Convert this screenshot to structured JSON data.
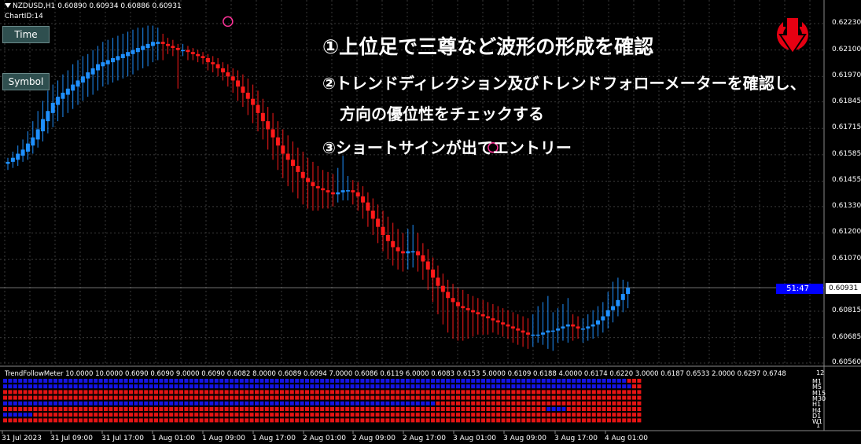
{
  "header": {
    "symbol_line": "NZDUSD,H1  0.60890 0.60934 0.60886 0.60931",
    "chart_id": "ChartID:14"
  },
  "buttons": {
    "time": "Time",
    "symbol": "Symbol"
  },
  "annotations": {
    "line1": "①上位足で三尊など波形の形成を確認",
    "line2": "②トレンドディレクション及びトレンドフォローメーターを確認し、",
    "line3": "方向の優位性をチェックする",
    "line4": "③ショートサインが出てエントリー"
  },
  "price_axis": {
    "labels": [
      "0.62230",
      "0.62100",
      "0.61970",
      "0.61845",
      "0.61715",
      "0.61585",
      "0.61455",
      "0.61330",
      "0.61200",
      "0.61070",
      "0.60815",
      "0.60685",
      "0.60560"
    ],
    "current_price": "0.60931",
    "timer": "51:47"
  },
  "indicator": {
    "title": "TrendFollowMeter 10.0000 10.0000 0.6090 0.6090 9.0000 0.6090 0.6082 8.0000 0.6089 0.6094 7.0000 0.6086 0.6119 6.0000 0.6083 0.6153 5.0000 0.6109 0.6188 4.0000 0.6174 0.6220 3.0000 0.6187 0.6533 2.0000 0.6297 0.6748",
    "scale_top": "12",
    "scale_bottom": "1",
    "timeframes": [
      "M1",
      "M5",
      "M15",
      "M30",
      "H1",
      "H4",
      "D1",
      "W1"
    ]
  },
  "time_axis": [
    "31 Jul 2023",
    "31 Jul 09:00",
    "31 Jul 17:00",
    "1 Aug 01:00",
    "1 Aug 09:00",
    "1 Aug 17:00",
    "2 Aug 01:00",
    "2 Aug 09:00",
    "2 Aug 17:00",
    "3 Aug 01:00",
    "3 Aug 09:00",
    "3 Aug 17:00",
    "4 Aug 01:00"
  ],
  "colors": {
    "bull": "#1e90ff",
    "bear": "#ff1a1a",
    "grid": "#3a3a3a",
    "meter_blue": "#1414e6",
    "meter_red": "#e61414",
    "marker": "#ff3399",
    "logo": "#e60012"
  },
  "chart_data": {
    "type": "candlestick",
    "instrument": "NZDUSD",
    "timeframe": "H1",
    "ylim": [
      0.6056,
      0.6223
    ],
    "markers": [
      {
        "x": 44,
        "y": 0.6224,
        "shape": "circle"
      },
      {
        "x": 97,
        "y": 0.6162,
        "shape": "circle"
      }
    ],
    "candles": [
      {
        "o": 0.6154,
        "c": 0.6155,
        "h": 0.6157,
        "l": 0.6151
      },
      {
        "o": 0.6155,
        "c": 0.6157,
        "h": 0.616,
        "l": 0.6152
      },
      {
        "o": 0.6156,
        "c": 0.6159,
        "h": 0.6163,
        "l": 0.6153
      },
      {
        "o": 0.6158,
        "c": 0.6161,
        "h": 0.6166,
        "l": 0.6155
      },
      {
        "o": 0.616,
        "c": 0.6164,
        "h": 0.617,
        "l": 0.6156
      },
      {
        "o": 0.6163,
        "c": 0.6167,
        "h": 0.6175,
        "l": 0.6159
      },
      {
        "o": 0.6166,
        "c": 0.6171,
        "h": 0.618,
        "l": 0.6162
      },
      {
        "o": 0.617,
        "c": 0.6176,
        "h": 0.6185,
        "l": 0.6165
      },
      {
        "o": 0.6175,
        "c": 0.618,
        "h": 0.619,
        "l": 0.6169
      },
      {
        "o": 0.6179,
        "c": 0.6184,
        "h": 0.6193,
        "l": 0.6172
      },
      {
        "o": 0.6183,
        "c": 0.6187,
        "h": 0.6195,
        "l": 0.6175
      },
      {
        "o": 0.6186,
        "c": 0.6189,
        "h": 0.6198,
        "l": 0.6177
      },
      {
        "o": 0.6188,
        "c": 0.6191,
        "h": 0.62,
        "l": 0.6179
      },
      {
        "o": 0.619,
        "c": 0.6193,
        "h": 0.6203,
        "l": 0.6181
      },
      {
        "o": 0.6192,
        "c": 0.6195,
        "h": 0.6205,
        "l": 0.6183
      },
      {
        "o": 0.6194,
        "c": 0.6197,
        "h": 0.6207,
        "l": 0.6185
      },
      {
        "o": 0.6196,
        "c": 0.6199,
        "h": 0.6208,
        "l": 0.6187
      },
      {
        "o": 0.6198,
        "c": 0.6201,
        "h": 0.621,
        "l": 0.6188
      },
      {
        "o": 0.62,
        "c": 0.6203,
        "h": 0.6212,
        "l": 0.619
      },
      {
        "o": 0.6202,
        "c": 0.6204,
        "h": 0.6214,
        "l": 0.6192
      },
      {
        "o": 0.6203,
        "c": 0.6205,
        "h": 0.6215,
        "l": 0.6193
      },
      {
        "o": 0.6204,
        "c": 0.6206,
        "h": 0.6216,
        "l": 0.6194
      },
      {
        "o": 0.6205,
        "c": 0.6207,
        "h": 0.6217,
        "l": 0.6195
      },
      {
        "o": 0.6206,
        "c": 0.6208,
        "h": 0.6218,
        "l": 0.6196
      },
      {
        "o": 0.6207,
        "c": 0.6209,
        "h": 0.6219,
        "l": 0.6197
      },
      {
        "o": 0.6208,
        "c": 0.621,
        "h": 0.622,
        "l": 0.6198
      },
      {
        "o": 0.6209,
        "c": 0.6211,
        "h": 0.6221,
        "l": 0.62
      },
      {
        "o": 0.621,
        "c": 0.6212,
        "h": 0.6221,
        "l": 0.6201
      },
      {
        "o": 0.6211,
        "c": 0.6213,
        "h": 0.6222,
        "l": 0.6202
      },
      {
        "o": 0.6212,
        "c": 0.6214,
        "h": 0.6222,
        "l": 0.6204
      },
      {
        "o": 0.6213,
        "c": 0.6214,
        "h": 0.6221,
        "l": 0.6205
      },
      {
        "o": 0.6214,
        "c": 0.6213,
        "h": 0.6218,
        "l": 0.6205
      },
      {
        "o": 0.6213,
        "c": 0.6212,
        "h": 0.6216,
        "l": 0.6208
      },
      {
        "o": 0.6212,
        "c": 0.6211,
        "h": 0.6215,
        "l": 0.6207
      },
      {
        "o": 0.6211,
        "c": 0.621,
        "h": 0.6213,
        "l": 0.6191
      },
      {
        "o": 0.621,
        "c": 0.621,
        "h": 0.6213,
        "l": 0.6207
      },
      {
        "o": 0.621,
        "c": 0.6209,
        "h": 0.6212,
        "l": 0.6205
      },
      {
        "o": 0.6209,
        "c": 0.6208,
        "h": 0.6211,
        "l": 0.6205
      },
      {
        "o": 0.6208,
        "c": 0.6207,
        "h": 0.621,
        "l": 0.6204
      },
      {
        "o": 0.6207,
        "c": 0.6206,
        "h": 0.6209,
        "l": 0.6203
      },
      {
        "o": 0.6206,
        "c": 0.6204,
        "h": 0.6208,
        "l": 0.62
      },
      {
        "o": 0.6204,
        "c": 0.6203,
        "h": 0.6207,
        "l": 0.6199
      },
      {
        "o": 0.6203,
        "c": 0.6201,
        "h": 0.6206,
        "l": 0.6197
      },
      {
        "o": 0.6201,
        "c": 0.6199,
        "h": 0.6204,
        "l": 0.6195
      },
      {
        "o": 0.6199,
        "c": 0.6197,
        "h": 0.6203,
        "l": 0.6192
      },
      {
        "o": 0.6197,
        "c": 0.6195,
        "h": 0.6201,
        "l": 0.6189
      },
      {
        "o": 0.6195,
        "c": 0.6192,
        "h": 0.62,
        "l": 0.6185
      },
      {
        "o": 0.6192,
        "c": 0.6189,
        "h": 0.6198,
        "l": 0.6182
      },
      {
        "o": 0.6189,
        "c": 0.6186,
        "h": 0.6196,
        "l": 0.6178
      },
      {
        "o": 0.6186,
        "c": 0.6183,
        "h": 0.6193,
        "l": 0.6174
      },
      {
        "o": 0.6183,
        "c": 0.6179,
        "h": 0.619,
        "l": 0.617
      },
      {
        "o": 0.6179,
        "c": 0.6175,
        "h": 0.6186,
        "l": 0.6166
      },
      {
        "o": 0.6175,
        "c": 0.6171,
        "h": 0.6182,
        "l": 0.6161
      },
      {
        "o": 0.6171,
        "c": 0.6167,
        "h": 0.6179,
        "l": 0.6156
      },
      {
        "o": 0.6167,
        "c": 0.6163,
        "h": 0.6175,
        "l": 0.6151
      },
      {
        "o": 0.6163,
        "c": 0.6159,
        "h": 0.6171,
        "l": 0.6147
      },
      {
        "o": 0.6159,
        "c": 0.6156,
        "h": 0.6168,
        "l": 0.6143
      },
      {
        "o": 0.6156,
        "c": 0.6153,
        "h": 0.6165,
        "l": 0.614
      },
      {
        "o": 0.6153,
        "c": 0.615,
        "h": 0.6162,
        "l": 0.6137
      },
      {
        "o": 0.615,
        "c": 0.6147,
        "h": 0.616,
        "l": 0.6134
      },
      {
        "o": 0.6147,
        "c": 0.6145,
        "h": 0.6157,
        "l": 0.6132
      },
      {
        "o": 0.6145,
        "c": 0.6143,
        "h": 0.6155,
        "l": 0.6131
      },
      {
        "o": 0.6143,
        "c": 0.6142,
        "h": 0.6153,
        "l": 0.6131
      },
      {
        "o": 0.6142,
        "c": 0.6141,
        "h": 0.6151,
        "l": 0.6132
      },
      {
        "o": 0.6141,
        "c": 0.614,
        "h": 0.615,
        "l": 0.6132
      },
      {
        "o": 0.614,
        "c": 0.6139,
        "h": 0.6149,
        "l": 0.6133
      },
      {
        "o": 0.6139,
        "c": 0.614,
        "h": 0.6152,
        "l": 0.6135
      },
      {
        "o": 0.614,
        "c": 0.6141,
        "h": 0.6158,
        "l": 0.6136
      },
      {
        "o": 0.6141,
        "c": 0.6141,
        "h": 0.6148,
        "l": 0.6136
      },
      {
        "o": 0.6141,
        "c": 0.614,
        "h": 0.6146,
        "l": 0.6134
      },
      {
        "o": 0.614,
        "c": 0.6138,
        "h": 0.6145,
        "l": 0.6131
      },
      {
        "o": 0.6138,
        "c": 0.6135,
        "h": 0.6143,
        "l": 0.6127
      },
      {
        "o": 0.6135,
        "c": 0.6131,
        "h": 0.614,
        "l": 0.6123
      },
      {
        "o": 0.6131,
        "c": 0.6127,
        "h": 0.6137,
        "l": 0.6119
      },
      {
        "o": 0.6127,
        "c": 0.6123,
        "h": 0.6134,
        "l": 0.6115
      },
      {
        "o": 0.6123,
        "c": 0.6119,
        "h": 0.6131,
        "l": 0.6111
      },
      {
        "o": 0.6119,
        "c": 0.6116,
        "h": 0.6128,
        "l": 0.6107
      },
      {
        "o": 0.6116,
        "c": 0.6113,
        "h": 0.6125,
        "l": 0.6104
      },
      {
        "o": 0.6113,
        "c": 0.6111,
        "h": 0.6122,
        "l": 0.6102
      },
      {
        "o": 0.6111,
        "c": 0.611,
        "h": 0.612,
        "l": 0.6101
      },
      {
        "o": 0.611,
        "c": 0.6111,
        "h": 0.6122,
        "l": 0.6102
      },
      {
        "o": 0.6111,
        "c": 0.6111,
        "h": 0.6124,
        "l": 0.6103
      },
      {
        "o": 0.6111,
        "c": 0.6109,
        "h": 0.612,
        "l": 0.6101
      },
      {
        "o": 0.6109,
        "c": 0.6106,
        "h": 0.6115,
        "l": 0.6097
      },
      {
        "o": 0.6106,
        "c": 0.6102,
        "h": 0.6112,
        "l": 0.6092
      },
      {
        "o": 0.6102,
        "c": 0.6098,
        "h": 0.6108,
        "l": 0.6086
      },
      {
        "o": 0.6098,
        "c": 0.6094,
        "h": 0.6104,
        "l": 0.608
      },
      {
        "o": 0.6094,
        "c": 0.6091,
        "h": 0.61,
        "l": 0.6075
      },
      {
        "o": 0.6091,
        "c": 0.6088,
        "h": 0.6097,
        "l": 0.6071
      },
      {
        "o": 0.6088,
        "c": 0.6086,
        "h": 0.6095,
        "l": 0.6068
      },
      {
        "o": 0.6086,
        "c": 0.6084,
        "h": 0.6093,
        "l": 0.6067
      },
      {
        "o": 0.6084,
        "c": 0.6083,
        "h": 0.6092,
        "l": 0.6067
      },
      {
        "o": 0.6083,
        "c": 0.6082,
        "h": 0.609,
        "l": 0.6068
      },
      {
        "o": 0.6082,
        "c": 0.6081,
        "h": 0.6089,
        "l": 0.6069
      },
      {
        "o": 0.6081,
        "c": 0.608,
        "h": 0.6088,
        "l": 0.607
      },
      {
        "o": 0.608,
        "c": 0.6079,
        "h": 0.6087,
        "l": 0.607
      },
      {
        "o": 0.6079,
        "c": 0.6078,
        "h": 0.6086,
        "l": 0.607
      },
      {
        "o": 0.6078,
        "c": 0.6077,
        "h": 0.6085,
        "l": 0.6071
      },
      {
        "o": 0.6077,
        "c": 0.6076,
        "h": 0.6084,
        "l": 0.607
      },
      {
        "o": 0.6076,
        "c": 0.6075,
        "h": 0.6083,
        "l": 0.6069
      },
      {
        "o": 0.6075,
        "c": 0.6074,
        "h": 0.6082,
        "l": 0.6068
      },
      {
        "o": 0.6074,
        "c": 0.6073,
        "h": 0.6081,
        "l": 0.6066
      },
      {
        "o": 0.6073,
        "c": 0.6072,
        "h": 0.608,
        "l": 0.6065
      },
      {
        "o": 0.6072,
        "c": 0.6071,
        "h": 0.6079,
        "l": 0.6064
      },
      {
        "o": 0.6071,
        "c": 0.607,
        "h": 0.6078,
        "l": 0.6063
      },
      {
        "o": 0.607,
        "c": 0.607,
        "h": 0.608,
        "l": 0.6064
      },
      {
        "o": 0.607,
        "c": 0.607,
        "h": 0.6084,
        "l": 0.6066
      },
      {
        "o": 0.607,
        "c": 0.6071,
        "h": 0.6086,
        "l": 0.6065
      },
      {
        "o": 0.6071,
        "c": 0.6072,
        "h": 0.6089,
        "l": 0.6063
      },
      {
        "o": 0.6072,
        "c": 0.6072,
        "h": 0.6081,
        "l": 0.6062
      },
      {
        "o": 0.6072,
        "c": 0.6073,
        "h": 0.6083,
        "l": 0.6066
      },
      {
        "o": 0.6073,
        "c": 0.6074,
        "h": 0.6085,
        "l": 0.6067
      },
      {
        "o": 0.6074,
        "c": 0.6075,
        "h": 0.6088,
        "l": 0.6066
      },
      {
        "o": 0.6075,
        "c": 0.6074,
        "h": 0.608,
        "l": 0.6067
      },
      {
        "o": 0.6074,
        "c": 0.6073,
        "h": 0.6079,
        "l": 0.6068
      },
      {
        "o": 0.6073,
        "c": 0.6073,
        "h": 0.6078,
        "l": 0.6066
      },
      {
        "o": 0.6073,
        "c": 0.6074,
        "h": 0.608,
        "l": 0.6067
      },
      {
        "o": 0.6074,
        "c": 0.6075,
        "h": 0.6082,
        "l": 0.6068
      },
      {
        "o": 0.6075,
        "c": 0.6077,
        "h": 0.6084,
        "l": 0.6069
      },
      {
        "o": 0.6077,
        "c": 0.6079,
        "h": 0.6086,
        "l": 0.6071
      },
      {
        "o": 0.6079,
        "c": 0.6082,
        "h": 0.6091,
        "l": 0.6073
      },
      {
        "o": 0.6082,
        "c": 0.6084,
        "h": 0.6096,
        "l": 0.6076
      },
      {
        "o": 0.6084,
        "c": 0.6087,
        "h": 0.6098,
        "l": 0.6079
      },
      {
        "o": 0.6087,
        "c": 0.609,
        "h": 0.6097,
        "l": 0.6081
      },
      {
        "o": 0.609,
        "c": 0.6093,
        "h": 0.6096,
        "l": 0.6083
      }
    ]
  }
}
